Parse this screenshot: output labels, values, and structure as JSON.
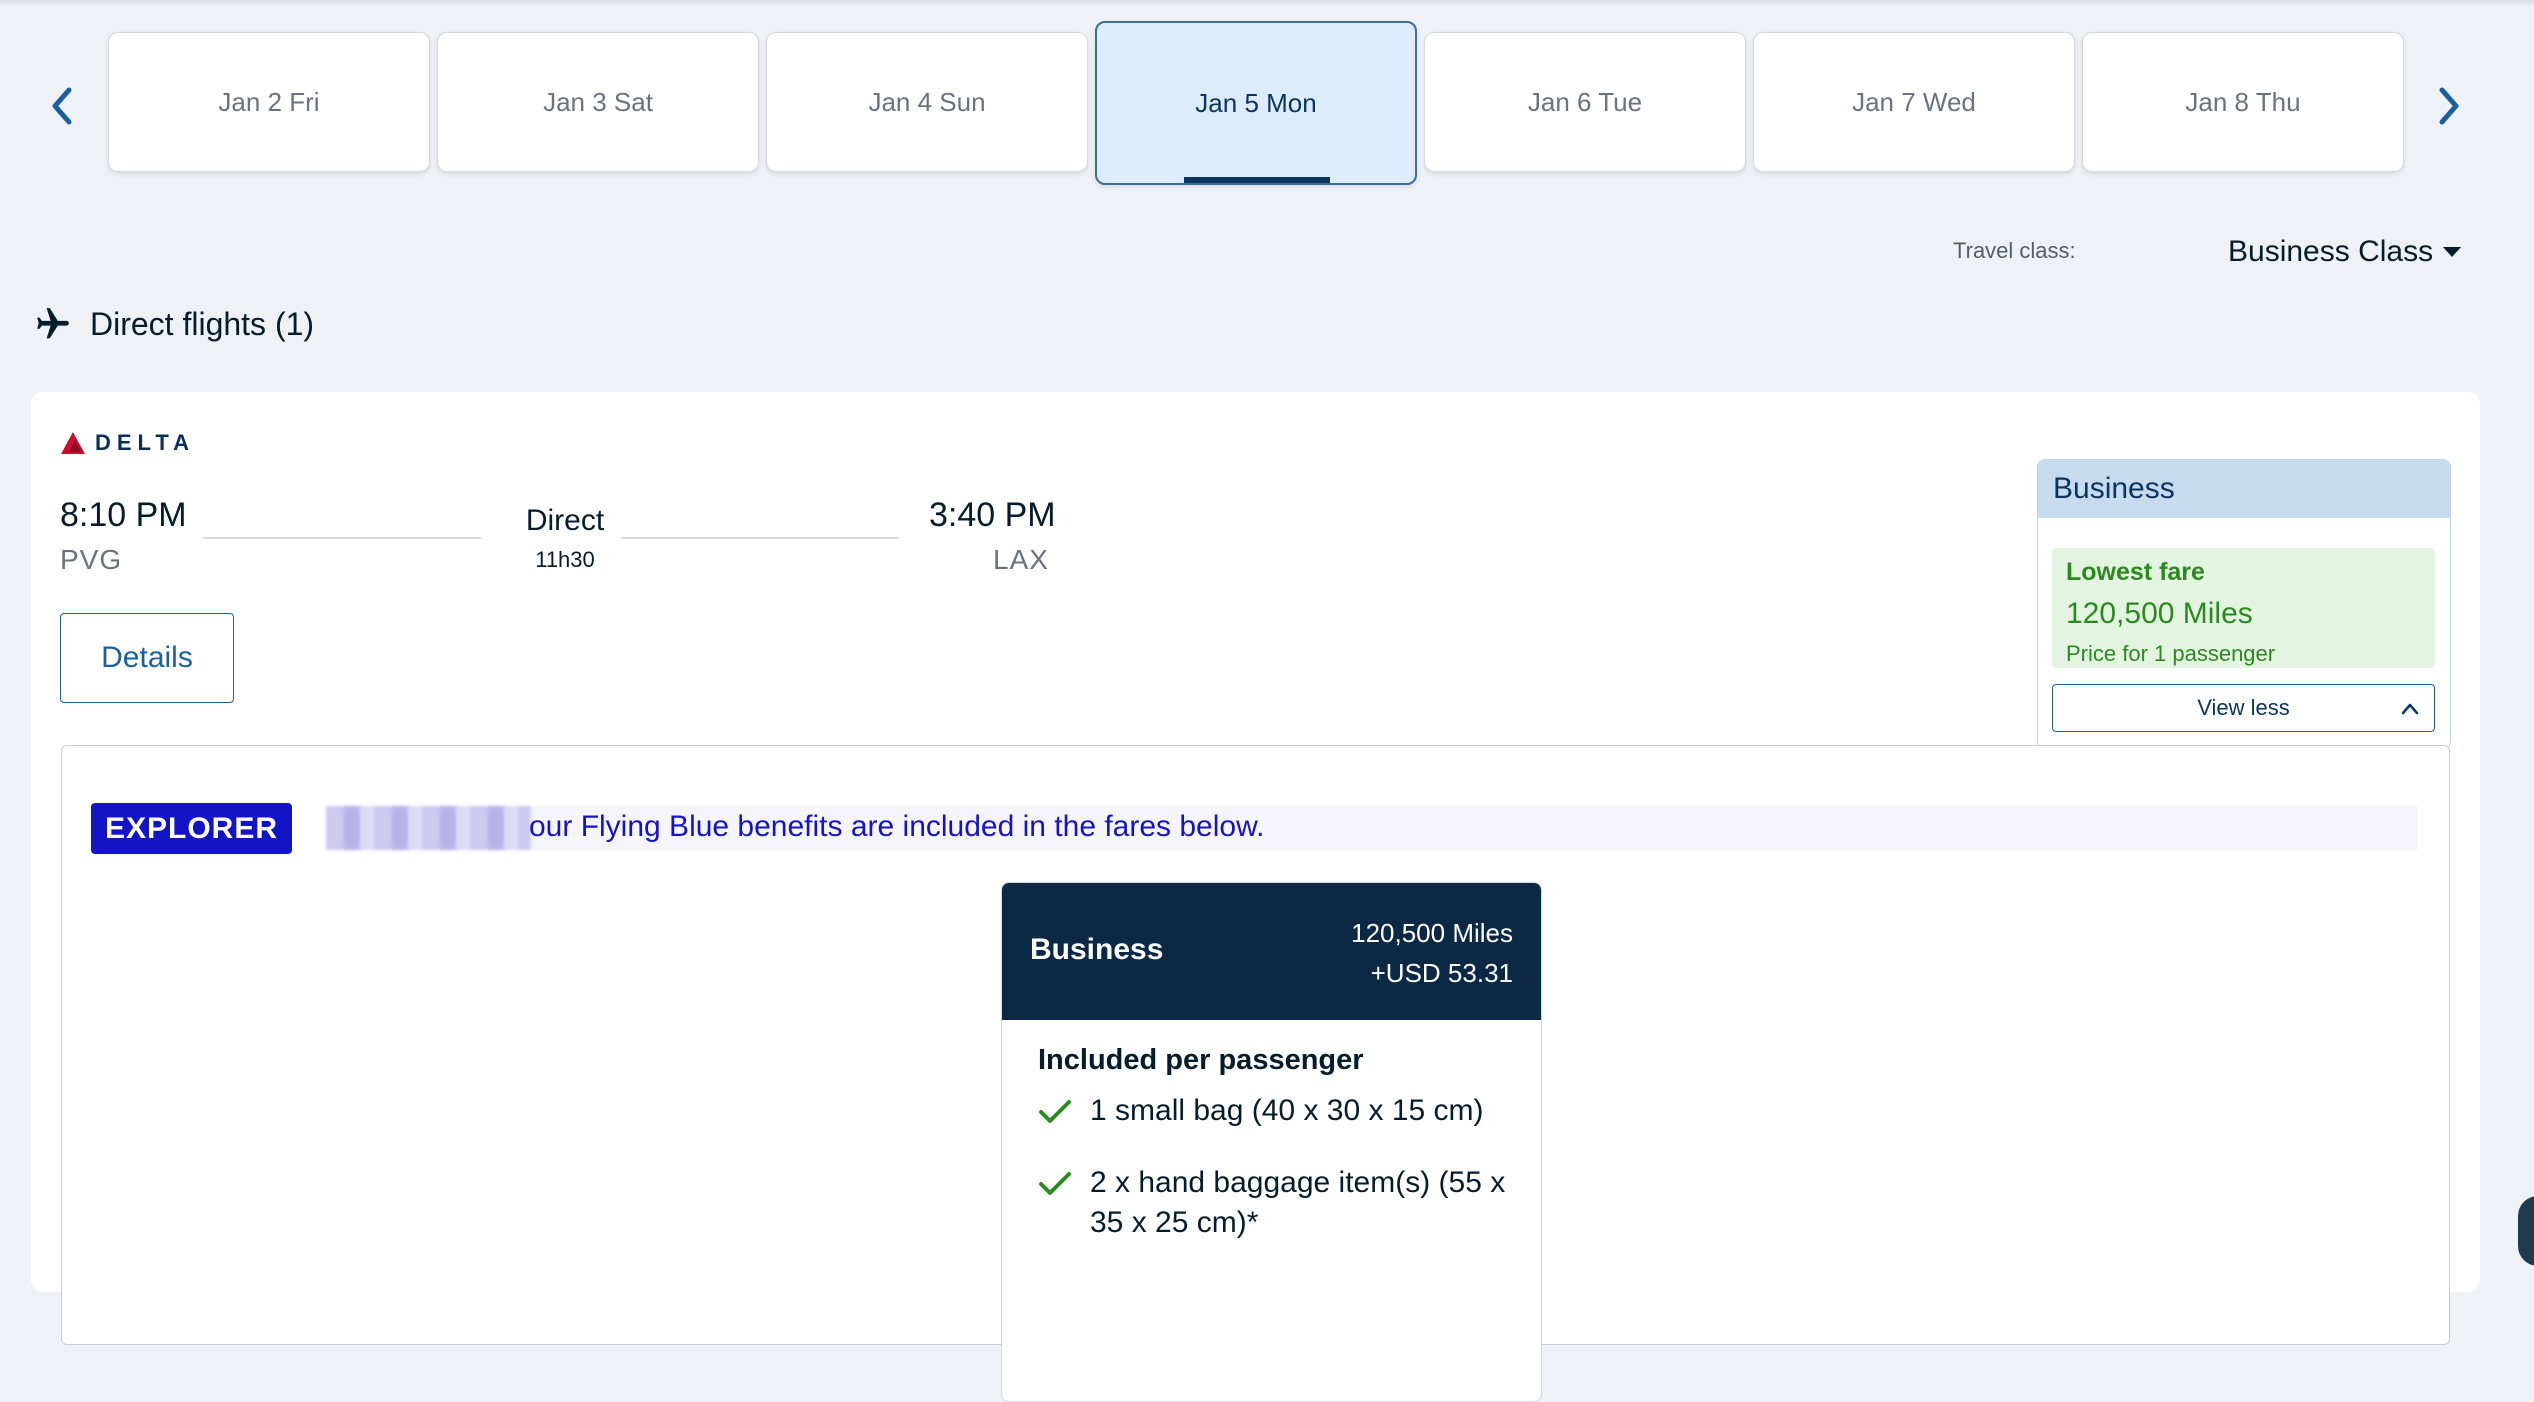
{
  "date_carousel": {
    "prev_icon": "chevron-left-icon",
    "next_icon": "chevron-right-icon",
    "dates": [
      {
        "label": "Jan 2 Fri",
        "selected": false
      },
      {
        "label": "Jan 3 Sat",
        "selected": false
      },
      {
        "label": "Jan 4 Sun",
        "selected": false
      },
      {
        "label": "Jan 5 Mon",
        "selected": true
      },
      {
        "label": "Jan 6 Tue",
        "selected": false
      },
      {
        "label": "Jan 7 Wed",
        "selected": false
      },
      {
        "label": "Jan 8 Thu",
        "selected": false
      }
    ]
  },
  "travel_class": {
    "label": "Travel class:",
    "value": "Business Class"
  },
  "results": {
    "header": "Direct flights (1)",
    "icon": "airplane-icon"
  },
  "flight": {
    "airline": "DELTA",
    "departure_time": "8:10 PM",
    "departure_airport": "PVG",
    "stops": "Direct",
    "duration": "11h30",
    "arrival_time": "3:40 PM",
    "arrival_airport": "LAX",
    "details_label": "Details"
  },
  "fare_summary": {
    "cabin": "Business",
    "lowest_fare_label": "Lowest fare",
    "miles": "120,500 Miles",
    "note": "Price for 1 passenger",
    "toggle_label": "View less"
  },
  "expanded": {
    "tier_badge": "EXPLORER",
    "benefit_text": "our Flying Blue benefits are included in the fares below.",
    "fare_card": {
      "cabin": "Business",
      "miles": "120,500 Miles",
      "surcharge": "+USD 53.31",
      "included_title": "Included per passenger",
      "items": [
        "1 small bag (40 x 30 x 15 cm)",
        "2 x hand baggage item(s) (55 x 35 x 25 cm)*"
      ]
    }
  },
  "colors": {
    "accent": "#1a5f9e",
    "selected_tab_bg": "#dcecfa",
    "explorer_badge": "#1414c7",
    "fare_header": "#0b2944",
    "lowest_fare_green": "#2b8a1f"
  }
}
